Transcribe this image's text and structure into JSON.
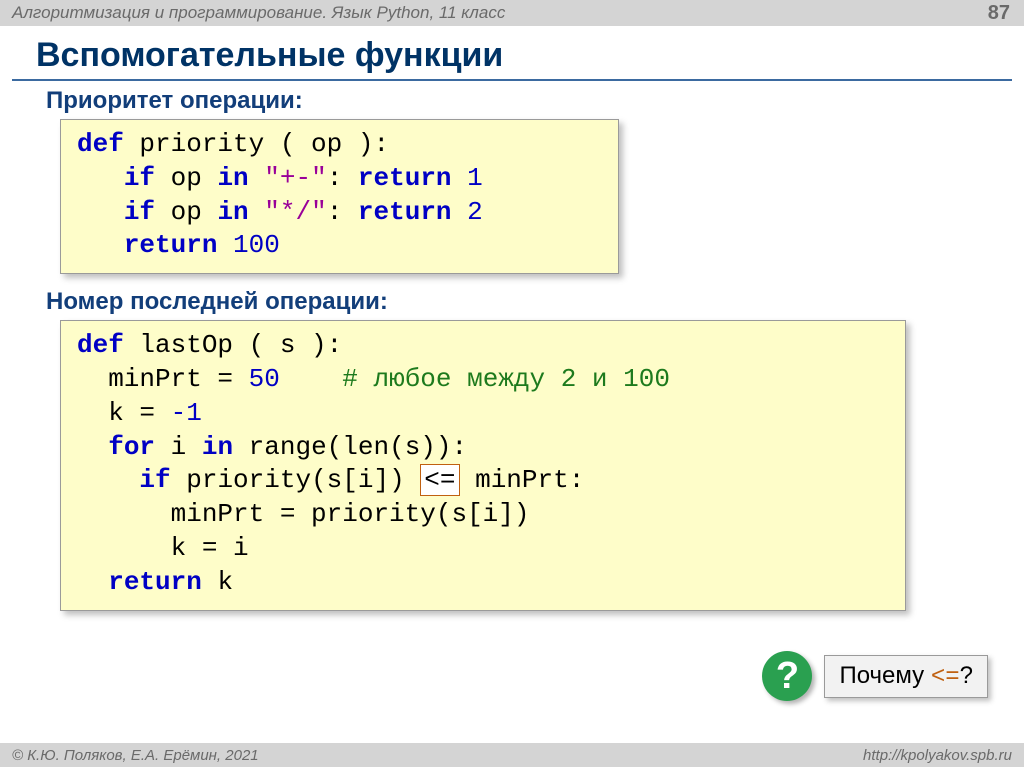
{
  "header": {
    "course": "Алгоритмизация и программирование. Язык Python, 11 класс",
    "page": "87"
  },
  "title": "Вспомогательные функции",
  "section1": {
    "heading": "Приоритет операции:",
    "code": {
      "l1_def": "def",
      "l1_name": " priority ( op ):",
      "l2_pre": "   ",
      "l2_if": "if",
      "l2_mid": " op ",
      "l2_in": "in",
      "l2_sp": " ",
      "l2_str": "\"+-\"",
      "l2_colon": ": ",
      "l2_ret": "return",
      "l2_sp2": " ",
      "l2_num": "1",
      "l3_pre": "   ",
      "l3_if": "if",
      "l3_mid": " op ",
      "l3_in": "in",
      "l3_sp": " ",
      "l3_str": "\"*/\"",
      "l3_colon": ": ",
      "l3_ret": "return",
      "l3_sp2": " ",
      "l3_num": "2",
      "l4_pre": "   ",
      "l4_ret": "return",
      "l4_sp": " ",
      "l4_num": "100"
    }
  },
  "section2": {
    "heading": "Номер последней операции:",
    "code": {
      "l1_def": "def",
      "l1_name": " lastOp ( s ):",
      "l2_pre": "  minPrt = ",
      "l2_num": "50",
      "l2_sp": "    ",
      "l2_cmt": "# любое между 2 и 100",
      "l3_pre": "  k = ",
      "l3_num": "-1",
      "l4_pre": "  ",
      "l4_for": "for",
      "l4_mid": " i ",
      "l4_in": "in",
      "l4_rest": " range(len(s)):",
      "l5_pre": "    ",
      "l5_if": "if",
      "l5_mid1": " priority(s[i]) ",
      "l5_op": "<=",
      "l5_mid2": " minPrt:",
      "l6": "      minPrt = priority(s[i])",
      "l7": "      k = i",
      "l8_pre": "  ",
      "l8_ret": "return",
      "l8_rest": " k"
    }
  },
  "callout": {
    "mark": "?",
    "text_a": "Почему ",
    "text_op": "<=",
    "text_b": "?"
  },
  "footer": {
    "left": "© К.Ю. Поляков, Е.А. Ерёмин, 2021",
    "right": "http://kpolyakov.spb.ru"
  }
}
